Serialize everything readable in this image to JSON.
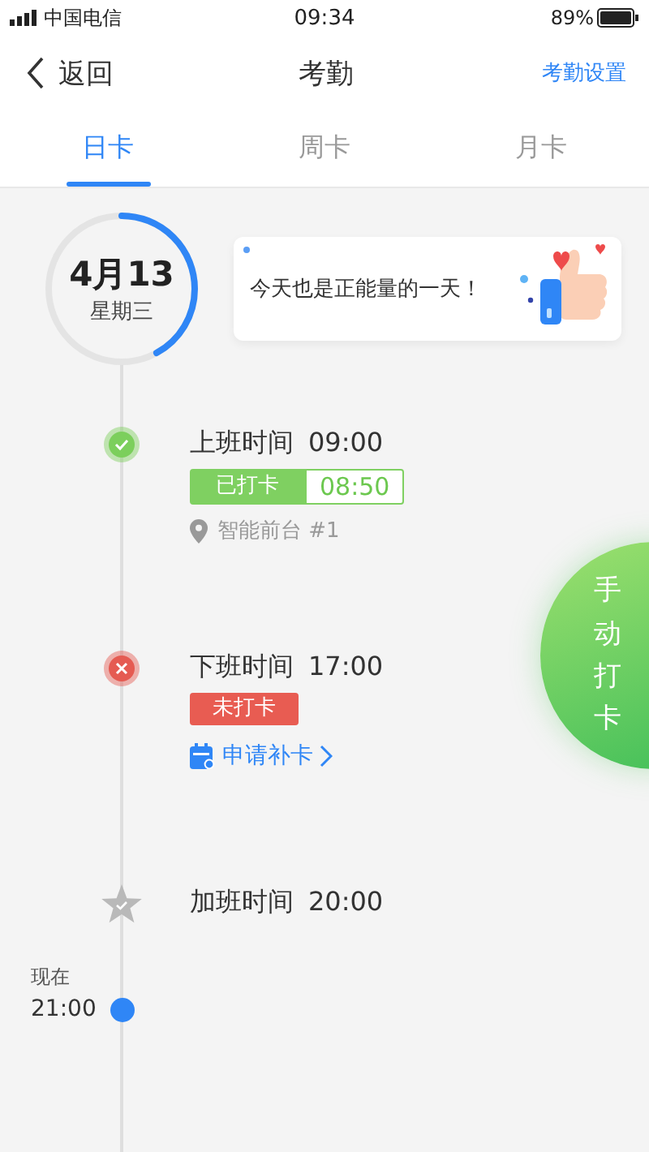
{
  "status_bar": {
    "carrier": "中国电信",
    "time": "09:34",
    "battery": "89%"
  },
  "nav": {
    "back": "返回",
    "title": "考勤",
    "action": "考勤设置"
  },
  "tabs": [
    {
      "label": "日卡",
      "selected": true
    },
    {
      "label": "周卡",
      "selected": false
    },
    {
      "label": "月卡",
      "selected": false
    }
  ],
  "date": {
    "date": "4月13",
    "weekday": "星期三",
    "level": 0.42
  },
  "banner": {
    "text": "今天也是正能量的一天！"
  },
  "records": [
    {
      "kind": "checked_in",
      "title": "上班时间",
      "time": "09:00",
      "status": "已打卡",
      "punch_time": "08:50",
      "location": "智能前台 #1"
    },
    {
      "kind": "missed",
      "title": "下班时间",
      "time": "17:00",
      "status": "未打卡",
      "link": "申请补卡"
    },
    {
      "kind": "overtime",
      "title": "加班时间",
      "time": "20:00"
    }
  ],
  "now": {
    "label": "现在",
    "time": "21:00"
  },
  "punch_button": {
    "label": "手动打卡"
  }
}
